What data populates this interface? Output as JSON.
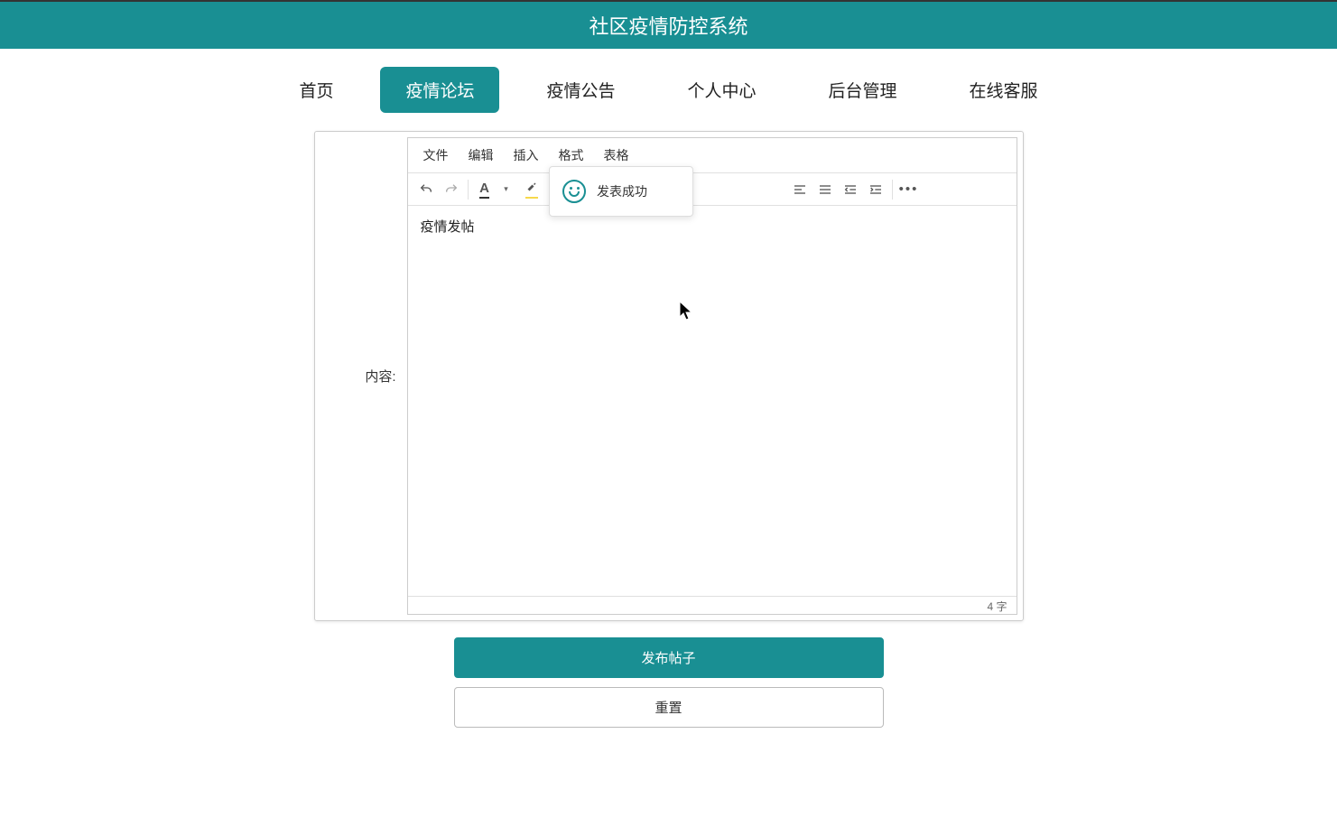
{
  "header": {
    "title": "社区疫情防控系统"
  },
  "nav": {
    "items": [
      {
        "label": "首页",
        "active": false
      },
      {
        "label": "疫情论坛",
        "active": true
      },
      {
        "label": "疫情公告",
        "active": false
      },
      {
        "label": "个人中心",
        "active": false
      },
      {
        "label": "后台管理",
        "active": false
      },
      {
        "label": "在线客服",
        "active": false
      }
    ]
  },
  "form": {
    "content_label": "内容:"
  },
  "editor": {
    "menubar": {
      "file": "文件",
      "edit": "编辑",
      "insert": "插入",
      "format": "格式",
      "table": "表格"
    },
    "content_text": "疫情发帖",
    "word_count": "4 字"
  },
  "buttons": {
    "publish": "发布帖子",
    "reset": "重置"
  },
  "toast": {
    "message": "发表成功"
  }
}
